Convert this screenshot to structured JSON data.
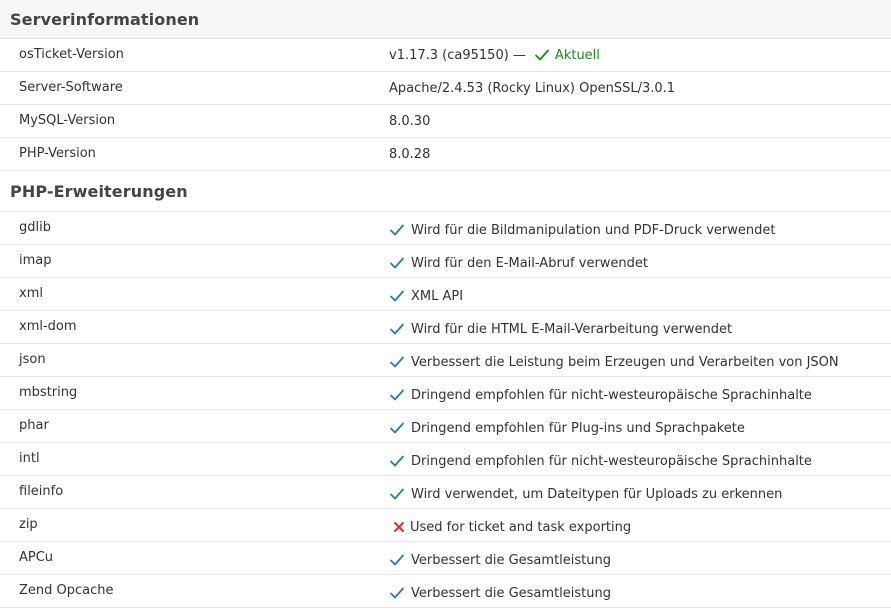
{
  "server_info": {
    "title": "Serverinformationen",
    "rows": [
      {
        "label": "osTicket-Version",
        "value": "v1.17.3 (ca95150) —",
        "status": "Aktuell"
      },
      {
        "label": "Server-Software",
        "value": "Apache/2.4.53 (Rocky Linux) OpenSSL/3.0.1"
      },
      {
        "label": "MySQL-Version",
        "value": "8.0.30"
      },
      {
        "label": "PHP-Version",
        "value": "8.0.28"
      }
    ]
  },
  "php_extensions": {
    "title": "PHP-Erweiterungen",
    "rows": [
      {
        "name": "gdlib",
        "ok": true,
        "description": "Wird für die Bildmanipulation und PDF-Druck verwendet"
      },
      {
        "name": "imap",
        "ok": true,
        "description": "Wird für den E-Mail-Abruf verwendet"
      },
      {
        "name": "xml",
        "ok": true,
        "description": "XML API"
      },
      {
        "name": "xml-dom",
        "ok": true,
        "description": "Wird für die HTML E-Mail-Verarbeitung verwendet"
      },
      {
        "name": "json",
        "ok": true,
        "description": "Verbessert die Leistung beim Erzeugen und Verarbeiten von JSON"
      },
      {
        "name": "mbstring",
        "ok": true,
        "description": "Dringend empfohlen für nicht-westeuropäische Sprachinhalte"
      },
      {
        "name": "phar",
        "ok": true,
        "description": "Dringend empfohlen für Plug-ins und Sprachpakete"
      },
      {
        "name": "intl",
        "ok": true,
        "description": "Dringend empfohlen für nicht-westeuropäische Sprachinhalte"
      },
      {
        "name": "fileinfo",
        "ok": true,
        "description": "Wird verwendet, um Dateitypen für Uploads zu erkennen"
      },
      {
        "name": "zip",
        "ok": false,
        "description": "Used for ticket and task exporting"
      },
      {
        "name": "APCu",
        "ok": true,
        "description": "Verbessert die Gesamtleistung"
      },
      {
        "name": "Zend Opcache",
        "ok": true,
        "description": "Verbessert die Gesamtleistung"
      }
    ]
  },
  "colors": {
    "check": "#2a7ab0",
    "cross": "#d9342b",
    "status_ok": "#1e8a1e"
  },
  "icons": {
    "ok": "check-icon",
    "missing": "cross-icon",
    "status_ok": "check-icon"
  }
}
